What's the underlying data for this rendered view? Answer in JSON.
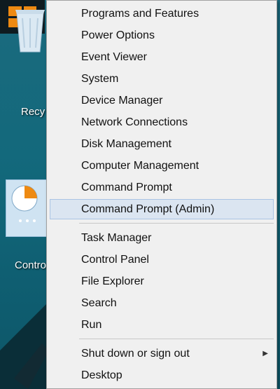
{
  "desktop": {
    "icons": [
      {
        "label": "Recy"
      },
      {
        "label": "Contro"
      }
    ]
  },
  "menu": {
    "items": [
      {
        "label": "Programs and Features"
      },
      {
        "label": "Power Options"
      },
      {
        "label": "Event Viewer"
      },
      {
        "label": "System"
      },
      {
        "label": "Device Manager"
      },
      {
        "label": "Network Connections"
      },
      {
        "label": "Disk Management"
      },
      {
        "label": "Computer Management"
      },
      {
        "label": "Command Prompt"
      },
      {
        "label": "Command Prompt (Admin)",
        "selected": true
      },
      {
        "label": "Task Manager"
      },
      {
        "label": "Control Panel"
      },
      {
        "label": "File Explorer"
      },
      {
        "label": "Search"
      },
      {
        "label": "Run"
      },
      {
        "label": "Shut down or sign out",
        "submenu": true
      },
      {
        "label": "Desktop"
      }
    ]
  },
  "colors": {
    "accent": "#ee8a12",
    "selection": "#dbe5f1",
    "menu_background": "#f0f0f0"
  }
}
